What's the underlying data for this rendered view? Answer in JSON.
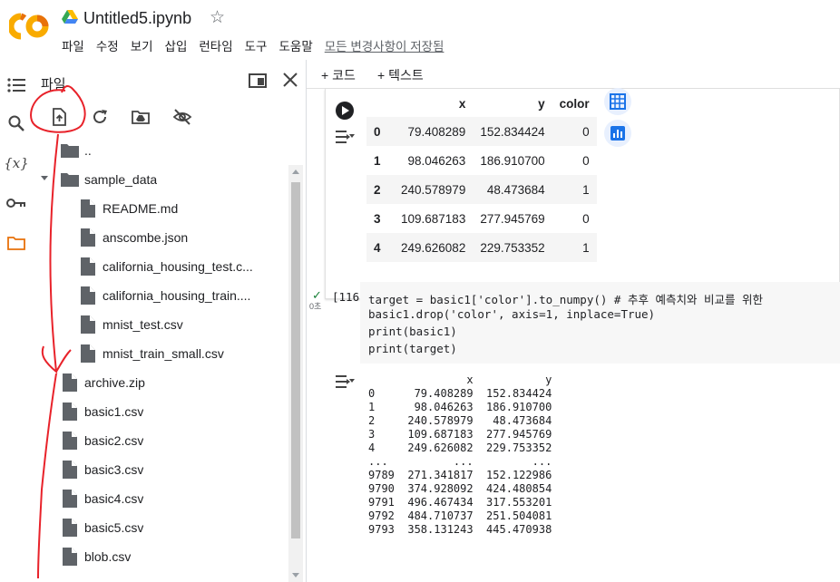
{
  "header": {
    "title": "Untitled5.ipynb",
    "menu": [
      "파일",
      "수정",
      "보기",
      "삽입",
      "런타임",
      "도구",
      "도움말"
    ],
    "save_status": "모든 변경사항이 저장됨"
  },
  "file_panel": {
    "title": "파일",
    "tree": [
      {
        "label": "..",
        "type": "folder",
        "depth": 0
      },
      {
        "label": "sample_data",
        "type": "folder",
        "depth": 0
      },
      {
        "label": "README.md",
        "type": "file",
        "depth": 1
      },
      {
        "label": "anscombe.json",
        "type": "file",
        "depth": 1
      },
      {
        "label": "california_housing_test.c...",
        "type": "file",
        "depth": 1
      },
      {
        "label": "california_housing_train....",
        "type": "file",
        "depth": 1
      },
      {
        "label": "mnist_test.csv",
        "type": "file",
        "depth": 1
      },
      {
        "label": "mnist_train_small.csv",
        "type": "file",
        "depth": 1
      },
      {
        "label": "archive.zip",
        "type": "file",
        "depth": 0
      },
      {
        "label": "basic1.csv",
        "type": "file",
        "depth": 0
      },
      {
        "label": "basic2.csv",
        "type": "file",
        "depth": 0
      },
      {
        "label": "basic3.csv",
        "type": "file",
        "depth": 0
      },
      {
        "label": "basic4.csv",
        "type": "file",
        "depth": 0
      },
      {
        "label": "basic5.csv",
        "type": "file",
        "depth": 0
      },
      {
        "label": "blob.csv",
        "type": "file",
        "depth": 0
      }
    ]
  },
  "toolbar": {
    "add_code": "+ 코드",
    "add_text": "+ 텍스트"
  },
  "prev_output": {
    "headers": [
      "",
      "x",
      "y",
      "color"
    ],
    "rows": [
      [
        "0",
        "79.408289",
        "152.834424",
        "0"
      ],
      [
        "1",
        "98.046263",
        "186.910700",
        "0"
      ],
      [
        "2",
        "240.578979",
        "48.473684",
        "1"
      ],
      [
        "3",
        "109.687183",
        "277.945769",
        "0"
      ],
      [
        "4",
        "249.626082",
        "229.753352",
        "1"
      ]
    ]
  },
  "code_cell": {
    "exec_count": "[116]",
    "exec_time": "0초",
    "lines": [
      "target = basic1['color'].to_numpy() # 추후 예측치와 비교를 위한",
      "basic1.drop('color', axis=1, inplace=True)",
      "print(basic1)",
      "print(target)"
    ]
  },
  "code_output": {
    "lines": [
      "               x           y",
      "0      79.408289  152.834424",
      "1      98.046263  186.910700",
      "2     240.578979   48.473684",
      "3     109.687183  277.945769",
      "4     249.626082  229.753352",
      "...          ...         ...",
      "9789  271.341817  152.122986",
      "9790  374.928092  424.480854",
      "9791  496.467434  317.553201",
      "9792  484.710737  251.504081",
      "9793  358.131243  445.470938"
    ]
  },
  "colors": {
    "accent_orange": "#f9ab00",
    "folder_gray": "#5f6368",
    "annotation_red": "#e8222a",
    "blue_icon": "#1a73e8"
  }
}
